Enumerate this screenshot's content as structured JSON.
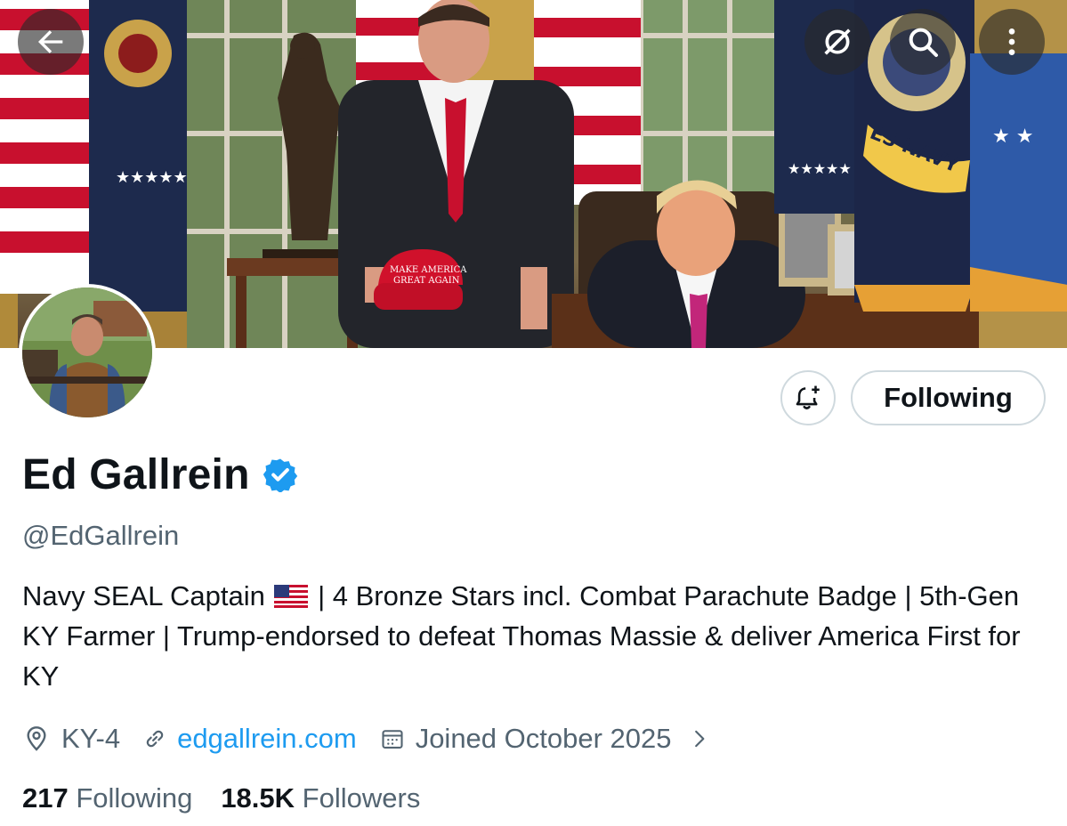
{
  "banner": {
    "hat_text_line1": "MAKE AMERICA",
    "hat_text_line2": "GREAT AGAIN",
    "flag_text": "ES NAVY"
  },
  "topbar": {
    "back_icon": "arrow-left-icon",
    "icons": [
      "eye-slash-icon",
      "search-icon",
      "more-vertical-icon"
    ]
  },
  "profile": {
    "name": "Ed Gallrein",
    "handle": "@EdGallrein",
    "verified_color": "#1d9bf0",
    "follow_button_label": "Following",
    "bio_part1": "Navy SEAL Captain",
    "bio_part2": " | 4 Bronze Stars incl. Combat Parachute Badge | 5th-Gen KY Farmer | Trump-endorsed to defeat Thomas Massie & deliver America First for KY",
    "location": "KY-4",
    "website": "edgallrein.com",
    "joined": "Joined October 2025",
    "following_count": "217",
    "following_label": "Following",
    "followers_count": "18.5K",
    "followers_label": "Followers"
  },
  "colors": {
    "accent": "#1d9bf0",
    "secondary_text": "#536471",
    "border": "#cfd9de"
  }
}
